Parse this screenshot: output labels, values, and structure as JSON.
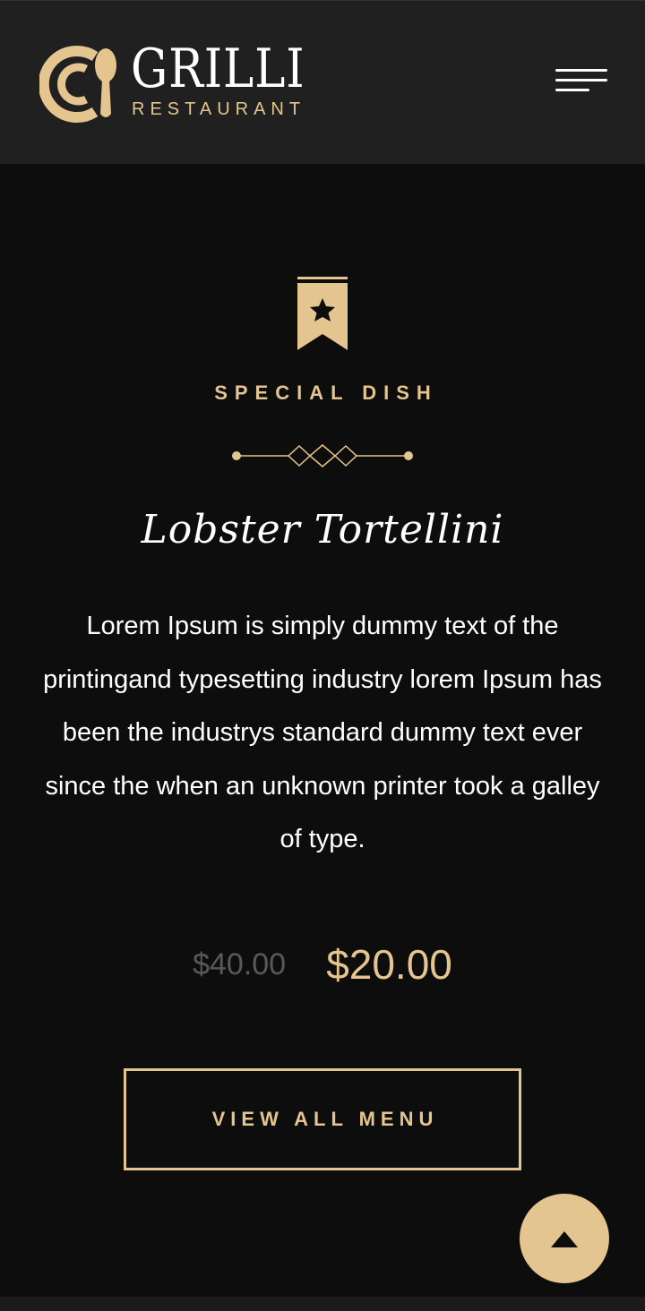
{
  "header": {
    "brand_title": "GRILLI",
    "brand_subtitle": "RESTAURANT"
  },
  "special": {
    "label": "SPECIAL DISH",
    "title": "Lobster Tortellini",
    "description": "Lorem Ipsum is simply dummy text of the printingand typesetting industry lorem Ipsum has been the industrys standard dummy text ever since the when an unknown printer took a galley of type.",
    "old_price": "$40.00",
    "new_price": "$20.00",
    "cta_label": "VIEW ALL MENU"
  },
  "icons": {
    "logo": "plate-spoon-logo-icon",
    "menu": "hamburger-menu-icon",
    "badge": "star-ribbon-icon",
    "separator": "diamond-separator-icon",
    "back_to_top": "caret-up-icon"
  },
  "colors": {
    "accent": "#e4c590",
    "header_bg": "#202020",
    "page_bg": "#0e0d0d",
    "text": "#ffffff",
    "muted_price": "#595959"
  }
}
